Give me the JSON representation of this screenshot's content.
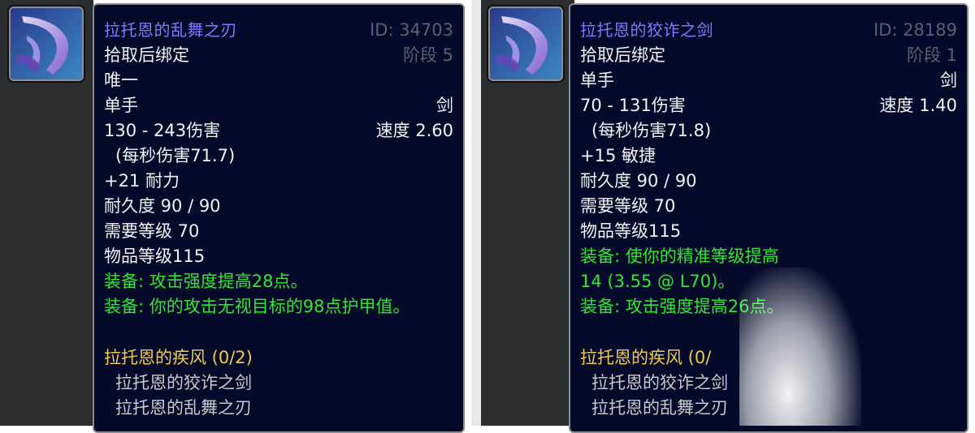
{
  "item_left": {
    "name": "拉托恩的乱舞之刃",
    "id_label": "ID: 34703",
    "bind": "拾取后绑定",
    "tier": "阶段 5",
    "unique": "唯一",
    "slot": "单手",
    "type": "剑",
    "damage": "130 - 243伤害",
    "speed": "速度 2.60",
    "dps": "(每秒伤害71.7)",
    "stat1": "+21 耐力",
    "durability": "耐久度 90 / 90",
    "req_level": "需要等级 70",
    "item_level": "物品等级115",
    "equip1": "装备:  攻击强度提高28点。",
    "equip2": "装备:  你的攻击无视目标的98点护甲值。",
    "set_name": "拉托恩的疾风  (0/2)",
    "set_items": [
      "拉托恩的狡诈之剑",
      "拉托恩的乱舞之刃"
    ],
    "icon": "sword-icon"
  },
  "item_right": {
    "name": "拉托恩的狡诈之剑",
    "id_label": "ID: 28189",
    "bind": "拾取后绑定",
    "tier": "阶段 1",
    "slot": "单手",
    "type": "剑",
    "damage": "70 - 131伤害",
    "speed": "速度 1.40",
    "dps": "(每秒伤害71.8)",
    "stat1": "+15 敏捷",
    "durability": "耐久度 90 / 90",
    "req_level": "需要等级 70",
    "item_level": "物品等级115",
    "equip1_line1": "装备:  使你的精准等级提高",
    "equip1_line2": "14 (3.55 @ L70)。",
    "equip2": "装备:  攻击强度提高26点。",
    "set_name": "拉托恩的疾风  (0/",
    "set_items": [
      "拉托恩的狡诈之剑",
      "拉托恩的乱舞之刃"
    ],
    "icon": "sword-icon"
  },
  "colors": {
    "tooltip_bg": "#060a2a",
    "title_blue": "#7b7cff",
    "equip_green": "#2fe82f",
    "set_gold": "#f1c94d"
  }
}
